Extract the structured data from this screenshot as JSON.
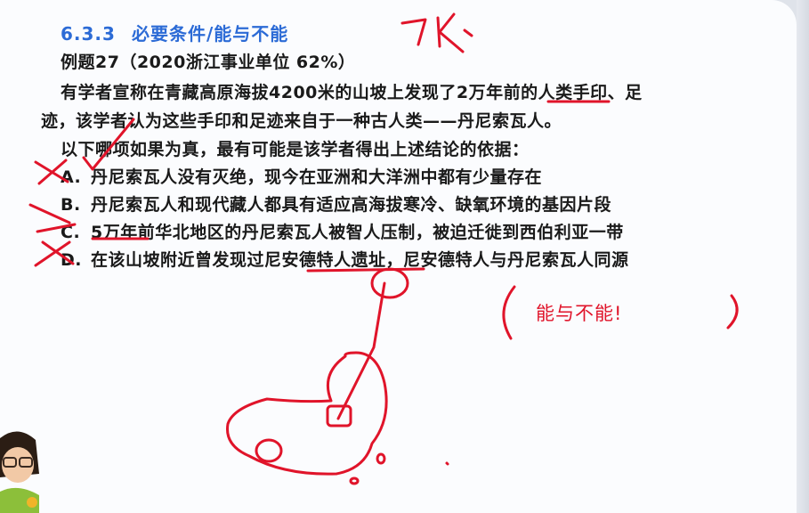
{
  "section": {
    "number": "6.3.3",
    "title": "必要条件/能与不能"
  },
  "example": {
    "label": "例题27（2020浙江事业单位  62%）"
  },
  "question": {
    "line1": "有学者宣称在青藏高原海拔4200米的山坡上发现了2万年前的人类手印、足",
    "line2": "迹，该学者认为这些手印和足迹来自于一种古人类——丹尼索瓦人。",
    "line3": "以下哪项如果为真，最有可能是该学者得出上述结论的依据："
  },
  "options": [
    {
      "letter": "A.",
      "text": "丹尼索瓦人没有灭绝，现今在亚洲和大洋洲中都有少量存在"
    },
    {
      "letter": "B.",
      "text": "丹尼索瓦人和现代藏人都具有适应高海拔寒冷、缺氧环境的基因片段"
    },
    {
      "letter": "C.",
      "text": "5万年前华北地区的丹尼索瓦人被智人压制，被迫迁徙到西伯利亚一带"
    },
    {
      "letter": "D.",
      "text": "在该山坡附近曾发现过尼安德特人遗址，尼安德特人与丹尼索瓦人同源"
    }
  ],
  "annotations": {
    "note": "能与不能!",
    "handwritten_top": "7K",
    "ink_color": "#e0142a"
  }
}
